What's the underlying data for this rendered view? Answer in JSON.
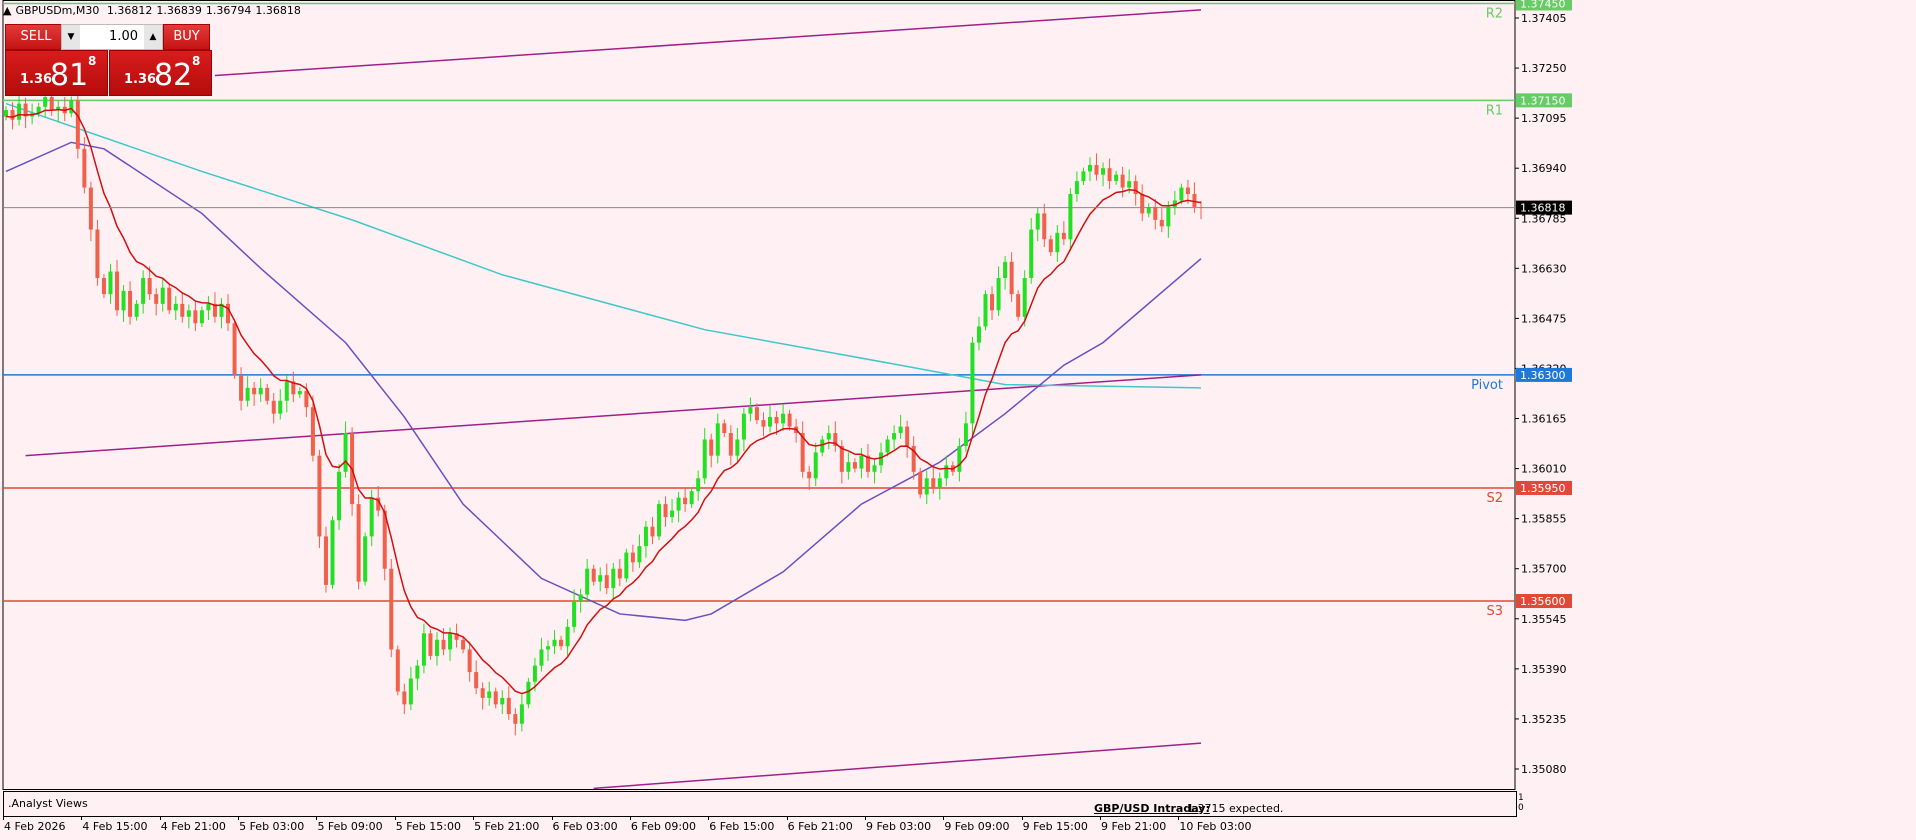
{
  "header": {
    "symbol": "GBPUSDm,M30",
    "open": "1.36812",
    "high": "1.36839",
    "low": "1.36794",
    "close": "1.36818"
  },
  "trade_panel": {
    "sell_label": "SELL",
    "buy_label": "BUY",
    "lots": "1.00",
    "bid": {
      "prefix": "1.36",
      "big": "81",
      "sup": "8"
    },
    "ask": {
      "prefix": "1.36",
      "big": "82",
      "sup": "8"
    }
  },
  "indicator": {
    "name": ".Analyst Views",
    "title": "GBP/USD Intraday:",
    "text": "1.3715 expected.",
    "scale_max": "1",
    "scale_min": "0"
  },
  "colors": {
    "bg": "#fff0f3",
    "bull": "#22e022",
    "bear": "#f0604a",
    "ma_fast": "#d01010",
    "ma_mid": "#6a4fc0",
    "ma_slow": "#40c8c8",
    "channel": "#a0208a",
    "resistance": "#66cc66",
    "pivot": "#1e78d8",
    "support": "#e04838"
  },
  "chart_data": {
    "type": "candlestick",
    "title": "GBPUSDm,M30",
    "ylim": [
      1.35018,
      1.3746
    ],
    "y_ticks": [
      "1.37405",
      "1.37250",
      "1.37095",
      "1.36940",
      "1.36785",
      "1.36630",
      "1.36475",
      "1.36320",
      "1.36165",
      "1.36010",
      "1.35855",
      "1.35700",
      "1.35545",
      "1.35390",
      "1.35235",
      "1.35080"
    ],
    "x_ticks": [
      "4 Feb 2026",
      "4 Feb 15:00",
      "4 Feb 21:00",
      "5 Feb 03:00",
      "5 Feb 09:00",
      "5 Feb 15:00",
      "5 Feb 21:00",
      "6 Feb 03:00",
      "6 Feb 09:00",
      "6 Feb 15:00",
      "6 Feb 21:00",
      "9 Feb 03:00",
      "9 Feb 09:00",
      "9 Feb 15:00",
      "9 Feb 21:00",
      "10 Feb 03:00"
    ],
    "bars_per_tick": 12,
    "current_price": "1.36818",
    "levels": [
      {
        "name": "R2",
        "price": "1.37450",
        "kind": "resistance"
      },
      {
        "name": "R1",
        "price": "1.37150",
        "kind": "resistance"
      },
      {
        "name": "Pivot",
        "price": "1.36300",
        "kind": "pivot"
      },
      {
        "name": "S2",
        "price": "1.35950",
        "kind": "support"
      },
      {
        "name": "S3",
        "price": "1.35600",
        "kind": "support"
      }
    ],
    "first_open": 1.371,
    "closes": [
      1.3712,
      1.3709,
      1.3714,
      1.371,
      1.3711,
      1.3713,
      1.3716,
      1.3712,
      1.3713,
      1.3711,
      1.3715,
      1.37,
      1.3688,
      1.3675,
      1.366,
      1.3655,
      1.3662,
      1.365,
      1.3656,
      1.3648,
      1.3652,
      1.366,
      1.3655,
      1.3652,
      1.3657,
      1.365,
      1.3652,
      1.3648,
      1.365,
      1.3646,
      1.365,
      1.3652,
      1.3648,
      1.3652,
      1.3646,
      1.363,
      1.3622,
      1.3626,
      1.3624,
      1.3626,
      1.3622,
      1.3618,
      1.3622,
      1.3628,
      1.3624,
      1.3625,
      1.362,
      1.3605,
      1.358,
      1.3565,
      1.3585,
      1.36,
      1.3612,
      1.359,
      1.3566,
      1.358,
      1.3592,
      1.3588,
      1.357,
      1.3545,
      1.3532,
      1.3528,
      1.3536,
      1.354,
      1.355,
      1.3543,
      1.3548,
      1.3545,
      1.355,
      1.3548,
      1.3545,
      1.3538,
      1.3533,
      1.353,
      1.3532,
      1.3528,
      1.353,
      1.3525,
      1.3522,
      1.3528,
      1.3535,
      1.354,
      1.3545,
      1.3546,
      1.3548,
      1.3546,
      1.3552,
      1.356,
      1.3562,
      1.357,
      1.3566,
      1.3568,
      1.3564,
      1.357,
      1.3567,
      1.3575,
      1.3572,
      1.3577,
      1.3583,
      1.358,
      1.359,
      1.3586,
      1.3588,
      1.3592,
      1.359,
      1.3594,
      1.3598,
      1.361,
      1.3605,
      1.3615,
      1.3612,
      1.3605,
      1.361,
      1.3618,
      1.362,
      1.3616,
      1.3614,
      1.3617,
      1.3615,
      1.3618,
      1.3614,
      1.3612,
      1.36,
      1.3598,
      1.3606,
      1.361,
      1.3612,
      1.3608,
      1.36,
      1.3603,
      1.3601,
      1.3605,
      1.36,
      1.3602,
      1.3606,
      1.361,
      1.3612,
      1.3614,
      1.3608,
      1.36,
      1.3593,
      1.3598,
      1.3595,
      1.3598,
      1.3602,
      1.36,
      1.3608,
      1.3615,
      1.364,
      1.3645,
      1.3655,
      1.365,
      1.366,
      1.3665,
      1.3655,
      1.3648,
      1.366,
      1.3675,
      1.368,
      1.3672,
      1.3668,
      1.3674,
      1.3672,
      1.3686,
      1.369,
      1.3693,
      1.3695,
      1.3692,
      1.3694,
      1.369,
      1.3692,
      1.3688,
      1.369,
      1.3686,
      1.368,
      1.3682,
      1.3678,
      1.3676,
      1.3682,
      1.3684,
      1.3688,
      1.3686,
      1.3682,
      1.36818
    ],
    "wick": 0.0003,
    "ma_fast_period": 10,
    "ma_mid": [
      [
        0,
        1.3693
      ],
      [
        10,
        1.3702
      ],
      [
        15,
        1.37
      ],
      [
        30,
        1.368
      ],
      [
        39,
        1.3663
      ],
      [
        52,
        1.364
      ],
      [
        61,
        1.3617
      ],
      [
        70,
        1.359
      ],
      [
        82,
        1.3567
      ],
      [
        94,
        1.3556
      ],
      [
        104,
        1.3554
      ],
      [
        108,
        1.3556
      ],
      [
        119,
        1.3569
      ],
      [
        131,
        1.359
      ],
      [
        143,
        1.3603
      ],
      [
        153,
        1.3618
      ],
      [
        162,
        1.3633
      ],
      [
        168,
        1.364
      ],
      [
        183,
        1.3666
      ]
    ],
    "ma_slow": [
      [
        0,
        1.3714
      ],
      [
        30,
        1.3693
      ],
      [
        53,
        1.3678
      ],
      [
        76,
        1.3661
      ],
      [
        107,
        1.3644
      ],
      [
        137,
        1.3633
      ],
      [
        153,
        1.3627
      ],
      [
        183,
        1.3626
      ]
    ],
    "channel": [
      [
        [
          32,
          1.37227
        ],
        [
          183,
          1.3743
        ]
      ],
      [
        [
          3,
          1.3605
        ],
        [
          183,
          1.363
        ]
      ],
      [
        [
          90,
          1.3502
        ],
        [
          183,
          1.3516
        ]
      ]
    ]
  }
}
